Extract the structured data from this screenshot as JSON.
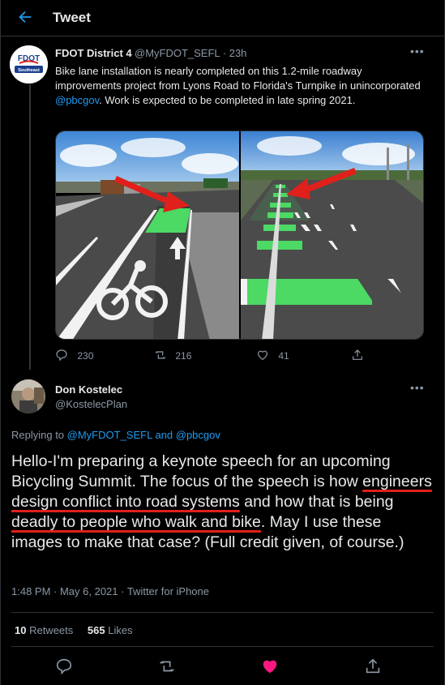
{
  "header": {
    "title": "Tweet"
  },
  "tweet1": {
    "name": "FDOT District 4",
    "handle_time": "@MyFDOT_SEFL · 23h",
    "text_a": "Bike lane installation is nearly completed on this 1.2-mile roadway improvements project from Lyons Road to Florida's Turnpike in unincorporated ",
    "mention": "@pbcgov",
    "text_b": ". Work is expected to be completed in late spring 2021.",
    "logo_top": "FDOT",
    "logo_bottom": "Southeast",
    "replies": "230",
    "retweets": "216",
    "likes": "41"
  },
  "tweet2": {
    "name": "Don Kostelec",
    "handle": "@KostelecPlan",
    "replying_prefix": "Replying to ",
    "replying_1": "@MyFDOT_SEFL",
    "replying_and": " and ",
    "replying_2": "@pbcgov",
    "body_1": "Hello-I'm preparing a keynote speech for an upcoming Bicycling Summit. The focus of the speech is how ",
    "body_u1": "engineers design conflict into road systems",
    "body_2": " and how that is being ",
    "body_u2": "deadly to people who walk and bike",
    "body_3": ". May I use these images to make that case? (Full credit given, of course.)",
    "meta": "1:48 PM · May 6, 2021 · Twitter for iPhone",
    "retweet_count": "10",
    "retweet_label": " Retweets",
    "like_count": "565",
    "like_label": " Likes"
  },
  "colors": {
    "accent": "#1d9bf0",
    "like": "#f91880",
    "bike_lane": "#4cd964",
    "annotation": "#e0201b"
  }
}
